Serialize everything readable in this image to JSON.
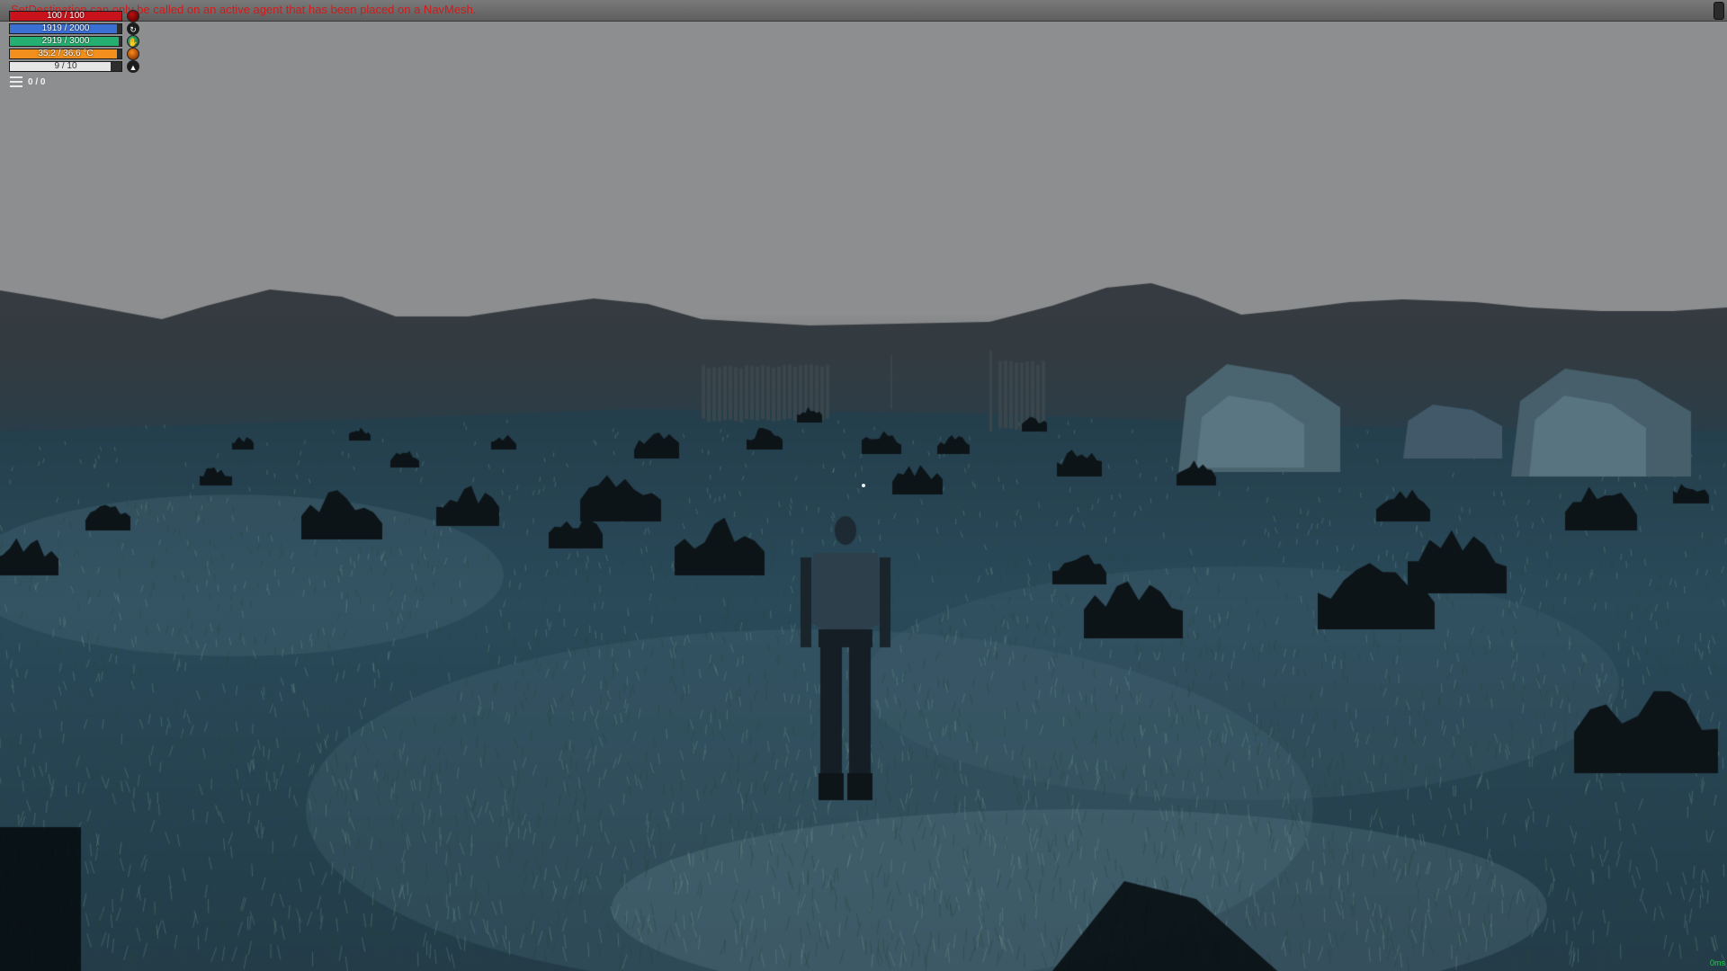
{
  "console": {
    "error_message": "SetDestination can only be called on an active agent that has been placed on a NavMesh."
  },
  "hud": {
    "stats": [
      {
        "key": "health",
        "text": "100 / 100",
        "current": 100,
        "max": 100,
        "color": "#c8131c",
        "icon": "health-orb-icon"
      },
      {
        "key": "mana",
        "text": "1919 / 2000",
        "current": 1919,
        "max": 2000,
        "color": "#3a6fd4",
        "icon": "mana-swirl-icon"
      },
      {
        "key": "stamina",
        "text": "2919 / 3000",
        "current": 2919,
        "max": 3000,
        "color": "#25b071",
        "icon": "stamina-hand-icon"
      },
      {
        "key": "temperature",
        "text": "35.2 / 36.6 °C",
        "current": 35.2,
        "max": 36.6,
        "color": "#f28f1d",
        "icon": "temperature-flame-icon"
      },
      {
        "key": "level",
        "text": "9 / 10",
        "current": 9,
        "max": 10,
        "color": "#e6e6e6",
        "icon": "level-chevron-icon"
      }
    ],
    "inventory": {
      "count": "0 / 0",
      "icon": "menu-lines-icon"
    }
  },
  "scene": {
    "sky_color": "#8d8e8f",
    "ground_color": "#2c4d5d",
    "fps_text": "0ms"
  }
}
